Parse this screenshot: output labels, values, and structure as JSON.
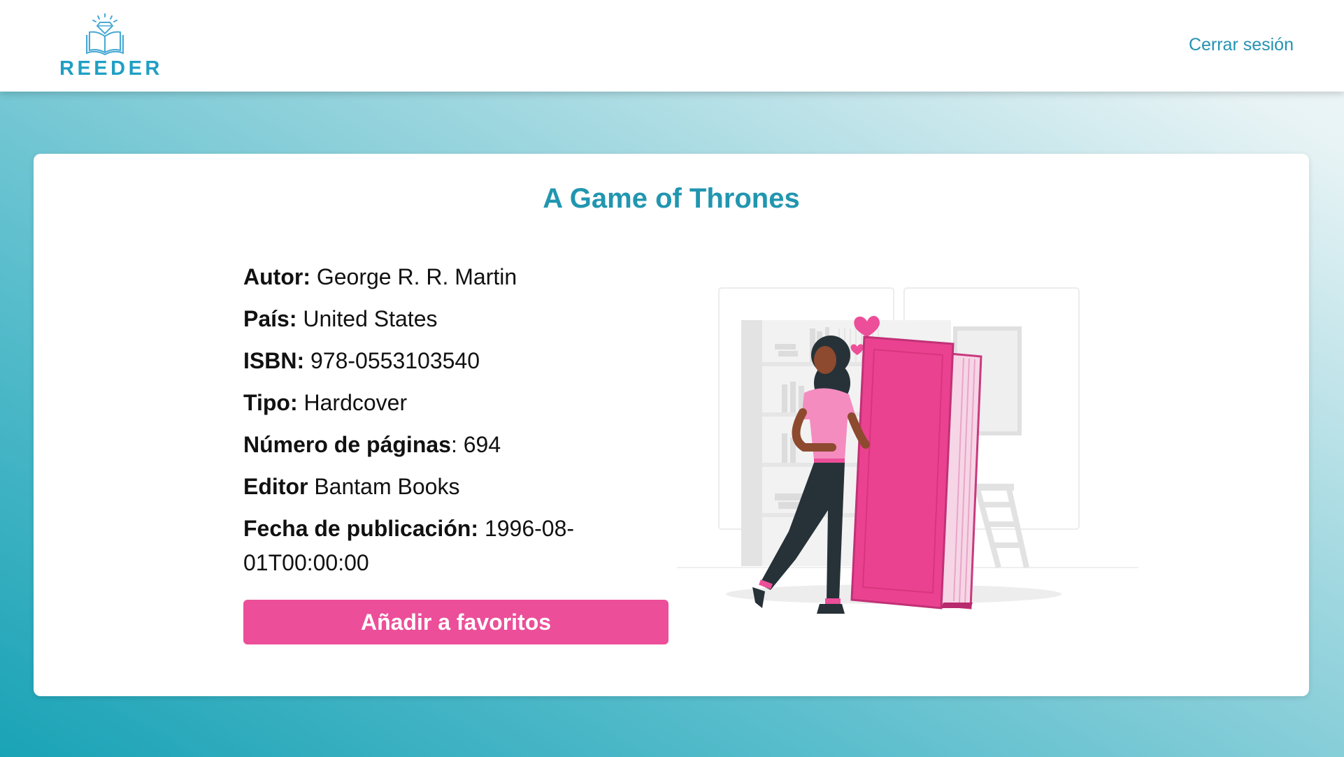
{
  "header": {
    "logo_text": "REEDER",
    "logout_label": "Cerrar sesión"
  },
  "book": {
    "title": "A Game of Thrones",
    "details": {
      "author_label": "Autor:",
      "author": "George R. R. Martin",
      "country_label": "País:",
      "country": "United States",
      "isbn_label": "ISBN:",
      "isbn": "978-0553103540",
      "type_label": "Tipo:",
      "type": "Hardcover",
      "pages_label": "Número de páginas",
      "pages": ": 694",
      "publisher_label": "Editor",
      "publisher": "Bantam Books",
      "date_label": "Fecha de publicación:",
      "date": "1996-08-01T00:00:00"
    },
    "favorite_button": "Añadir a favoritos"
  },
  "colors": {
    "accent": "#2196b0",
    "button": "#ec4e99",
    "logo": "#1f9fc4"
  },
  "icons": {
    "logo": "open-book-diamond-icon",
    "illustration": "woman-with-giant-book-illustration"
  }
}
